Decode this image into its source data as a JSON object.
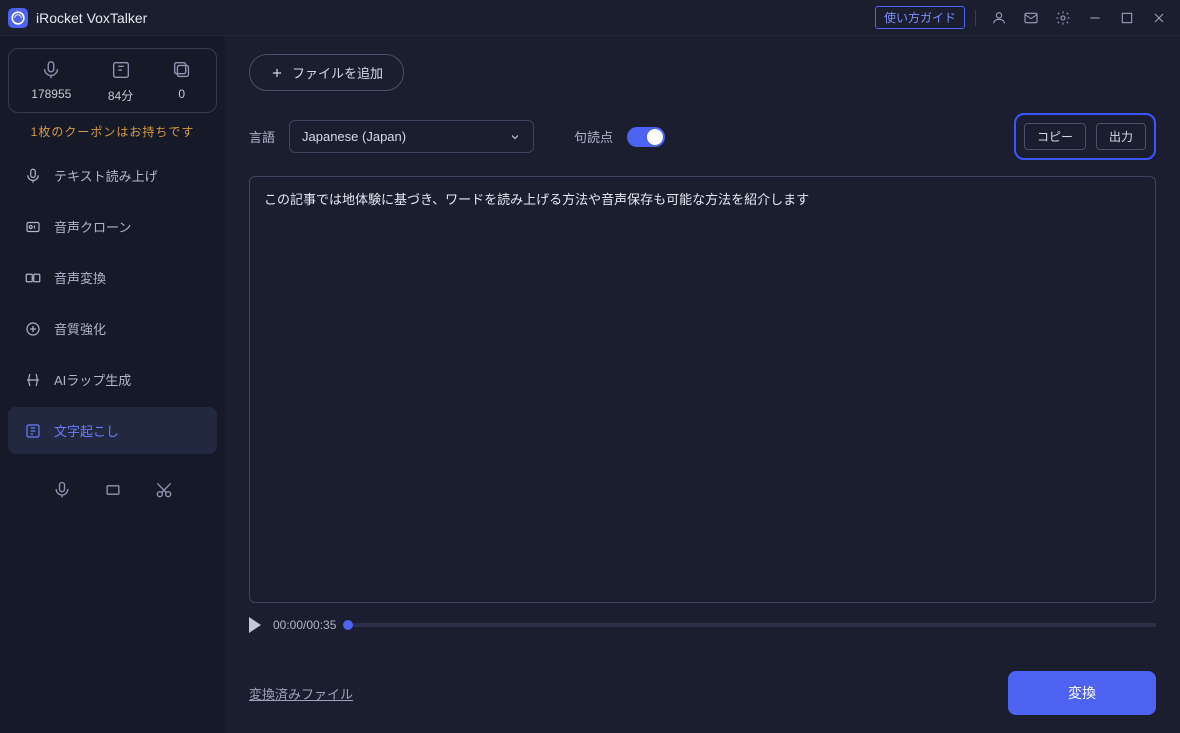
{
  "app": {
    "title": "iRocket VoxTalker",
    "guide_button": "使い方ガイド"
  },
  "sidebar": {
    "stats": [
      {
        "value": "178955"
      },
      {
        "value": "84分"
      },
      {
        "value": "0"
      }
    ],
    "coupon_note": "1枚のクーポンはお持ちです",
    "items": [
      {
        "label": "テキスト読み上げ"
      },
      {
        "label": "音声クローン"
      },
      {
        "label": "音声変換"
      },
      {
        "label": "音質強化"
      },
      {
        "label": "AIラップ生成"
      },
      {
        "label": "文字起こし"
      }
    ]
  },
  "main": {
    "add_file": "ファイルを追加",
    "lang_label": "言語",
    "lang_value": "Japanese (Japan)",
    "punctuation_label": "句読点",
    "copy_btn": "コピー",
    "export_btn": "出力",
    "textarea_value": "この記事では地体験に基づき、ワードを読み上げる方法や音声保存も可能な方法を紹介します",
    "player": {
      "current": "00:00",
      "total": "00:35"
    },
    "converted_link": "変換済みファイル",
    "convert_btn": "変換"
  }
}
